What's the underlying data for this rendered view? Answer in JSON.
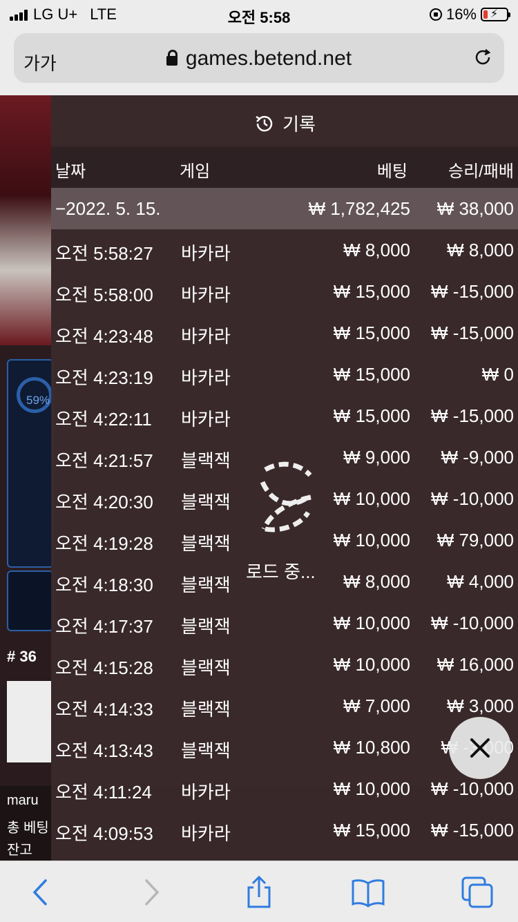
{
  "status": {
    "carrier": "LG U+",
    "network": "LTE",
    "time": "오전 5:58",
    "battery": "16%"
  },
  "browser": {
    "text_size": "가가",
    "url": "games.betend.net"
  },
  "background": {
    "progress_label": "59%",
    "table_number": "# 36",
    "line1": "maru",
    "line2": "총 베팅",
    "line3": "잔고"
  },
  "history": {
    "title": "기록",
    "columns": {
      "date": "날짜",
      "game": "게임",
      "bet": "베팅",
      "result": "승리/패배"
    },
    "date_group": {
      "date": "−2022. 5. 15.",
      "total_bet": "₩ 1,782,425",
      "total_result": "₩ 38,000"
    },
    "rows": [
      {
        "time": "오전 5:58:27",
        "game": "바카라",
        "bet": "₩ 8,000",
        "result": "₩ 8,000"
      },
      {
        "time": "오전 5:58:00",
        "game": "바카라",
        "bet": "₩ 15,000",
        "result": "₩ -15,000"
      },
      {
        "time": "오전 4:23:48",
        "game": "바카라",
        "bet": "₩ 15,000",
        "result": "₩ -15,000"
      },
      {
        "time": "오전 4:23:19",
        "game": "바카라",
        "bet": "₩ 15,000",
        "result": "₩ 0"
      },
      {
        "time": "오전 4:22:11",
        "game": "바카라",
        "bet": "₩ 15,000",
        "result": "₩ -15,000"
      },
      {
        "time": "오전 4:21:57",
        "game": "블랙잭",
        "bet": "₩ 9,000",
        "result": "₩ -9,000"
      },
      {
        "time": "오전 4:20:30",
        "game": "블랙잭",
        "bet": "₩ 10,000",
        "result": "₩ -10,000"
      },
      {
        "time": "오전 4:19:28",
        "game": "블랙잭",
        "bet": "₩ 10,000",
        "result": "₩ 79,000"
      },
      {
        "time": "오전 4:18:30",
        "game": "블랙잭",
        "bet": "₩ 8,000",
        "result": "₩ 4,000"
      },
      {
        "time": "오전 4:17:37",
        "game": "블랙잭",
        "bet": "₩ 10,000",
        "result": "₩ -10,000"
      },
      {
        "time": "오전 4:15:28",
        "game": "블랙잭",
        "bet": "₩ 10,000",
        "result": "₩ 16,000"
      },
      {
        "time": "오전 4:14:33",
        "game": "블랙잭",
        "bet": "₩ 7,000",
        "result": "₩ 3,000"
      },
      {
        "time": "오전 4:13:43",
        "game": "블랙잭",
        "bet": "₩ 10,800",
        "result": "₩ -3,000"
      },
      {
        "time": "오전 4:11:24",
        "game": "바카라",
        "bet": "₩ 10,000",
        "result": "₩ -10,000"
      },
      {
        "time": "오전 4:09:53",
        "game": "바카라",
        "bet": "₩ 15,000",
        "result": "₩ -15,000"
      }
    ],
    "loading_text": "로드 중..."
  },
  "icons": {
    "history": "history-clock-icon",
    "close": "close-icon",
    "back": "back-chevron-icon",
    "forward": "forward-chevron-icon",
    "share": "share-icon",
    "bookmarks": "book-icon",
    "tabs": "tabs-icon"
  },
  "colors": {
    "accent": "#2f7ce0",
    "overlay": "#3a2a2c"
  }
}
